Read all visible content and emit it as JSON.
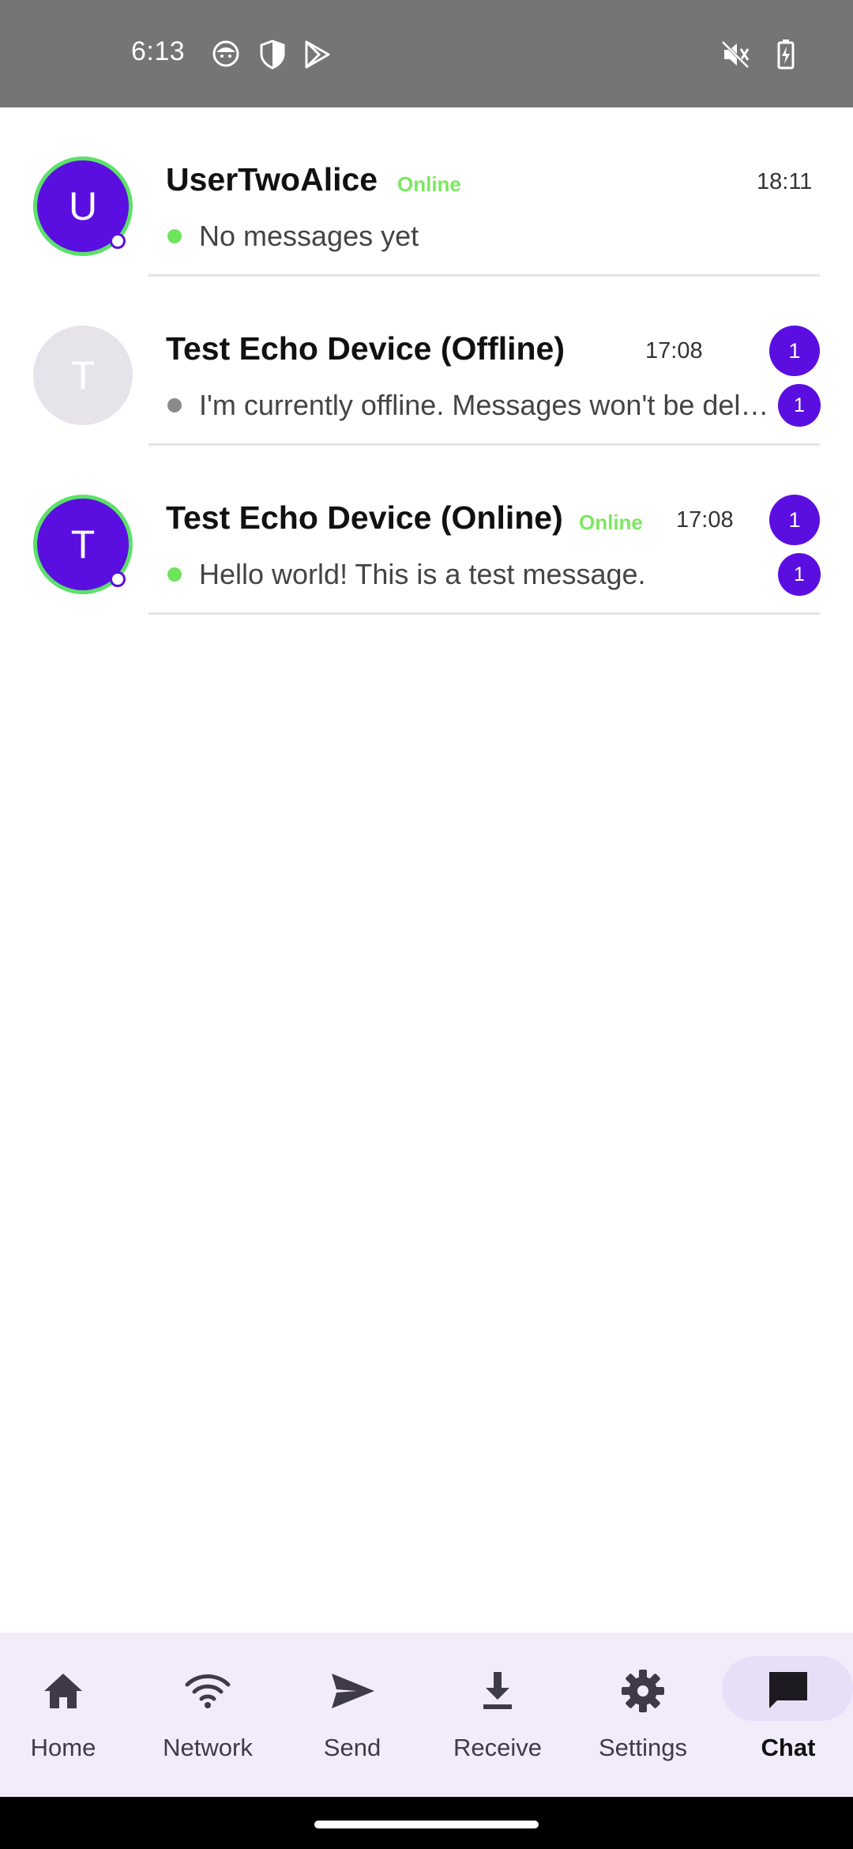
{
  "status_bar": {
    "time": "6:13",
    "icons": [
      "face-icon",
      "shield-icon",
      "play-store-icon",
      "mute-icon",
      "battery-charging-icon"
    ]
  },
  "chats": [
    {
      "avatar_letter": "U",
      "name": "UserTwoAlice",
      "status": "Online",
      "time": "18:11",
      "preview": "No messages yet",
      "presence": "online"
    },
    {
      "avatar_letter": "T",
      "name": "Test Echo Device (Offline)",
      "status": "",
      "time": "17:08",
      "preview": "I'm currently offline. Messages won't be delivered.",
      "presence": "offline",
      "badge_top": "1",
      "badge_bottom": "1"
    },
    {
      "avatar_letter": "T",
      "name": "Test Echo Device (Online)",
      "status": "Online",
      "time": "17:08",
      "preview": "Hello world! This is a test message.",
      "presence": "online",
      "badge_top": "1",
      "badge_bottom": "1"
    }
  ],
  "nav": {
    "items": [
      {
        "label": "Home",
        "icon": "home-icon"
      },
      {
        "label": "Network",
        "icon": "wifi-icon"
      },
      {
        "label": "Send",
        "icon": "send-icon"
      },
      {
        "label": "Receive",
        "icon": "download-icon"
      },
      {
        "label": "Settings",
        "icon": "gear-icon"
      },
      {
        "label": "Chat",
        "icon": "chat-icon"
      }
    ],
    "active": "Chat"
  },
  "colors": {
    "accent": "#5a0ee0",
    "online": "#5ce06a",
    "nav_background": "#f1ebfa"
  }
}
